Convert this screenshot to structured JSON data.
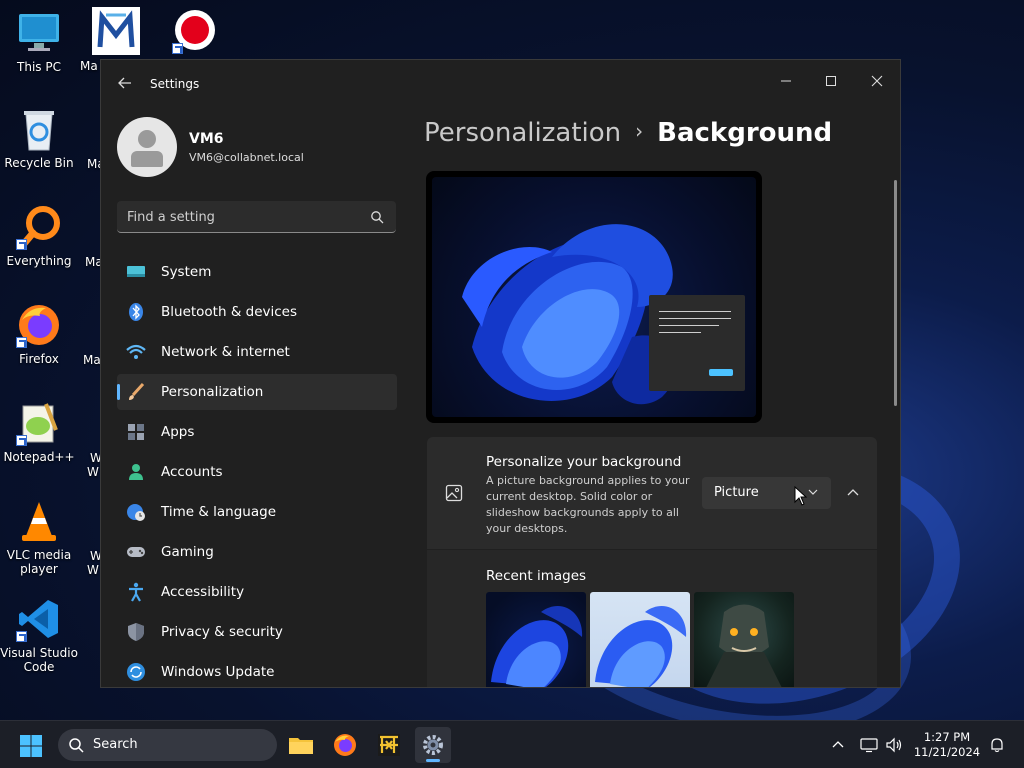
{
  "desktop": {
    "icons": [
      {
        "label": "This PC"
      },
      {
        "label": "Recycle Bin"
      },
      {
        "label": "Everything"
      },
      {
        "label": "Firefox"
      },
      {
        "label": "Notepad++"
      },
      {
        "label": "VLC media player"
      },
      {
        "label": "Visual Studio Code"
      }
    ],
    "partial_icon_labels": [
      "Ma",
      "Ma",
      "Ma",
      "Ma",
      "W",
      "W",
      "W",
      "W"
    ]
  },
  "window": {
    "title": "Settings",
    "user": {
      "name": "VM6",
      "email": "VM6@collabnet.local"
    },
    "search": {
      "placeholder": "Find a setting"
    },
    "nav": [
      {
        "label": "System",
        "icon": "monitor-icon"
      },
      {
        "label": "Bluetooth & devices",
        "icon": "bluetooth-icon"
      },
      {
        "label": "Network & internet",
        "icon": "wifi-icon"
      },
      {
        "label": "Personalization",
        "icon": "brush-icon",
        "active": true
      },
      {
        "label": "Apps",
        "icon": "apps-icon"
      },
      {
        "label": "Accounts",
        "icon": "person-icon"
      },
      {
        "label": "Time & language",
        "icon": "globe-clock-icon"
      },
      {
        "label": "Gaming",
        "icon": "gamepad-icon"
      },
      {
        "label": "Accessibility",
        "icon": "accessibility-icon"
      },
      {
        "label": "Privacy & security",
        "icon": "shield-icon"
      },
      {
        "label": "Windows Update",
        "icon": "update-icon"
      }
    ],
    "breadcrumb": {
      "parent": "Personalization",
      "separator": "›",
      "current": "Background"
    },
    "background_card": {
      "title": "Personalize your background",
      "description": "A picture background applies to your current desktop. Solid color or slideshow backgrounds apply to all your desktops.",
      "selected": "Picture"
    },
    "recent_images": {
      "title": "Recent images"
    }
  },
  "taskbar": {
    "search_label": "Search",
    "time": "1:27 PM",
    "date": "11/21/2024"
  },
  "colors": {
    "accent": "#60b6ff",
    "window_bg": "#202020",
    "card_bg": "#2b2b2b"
  }
}
